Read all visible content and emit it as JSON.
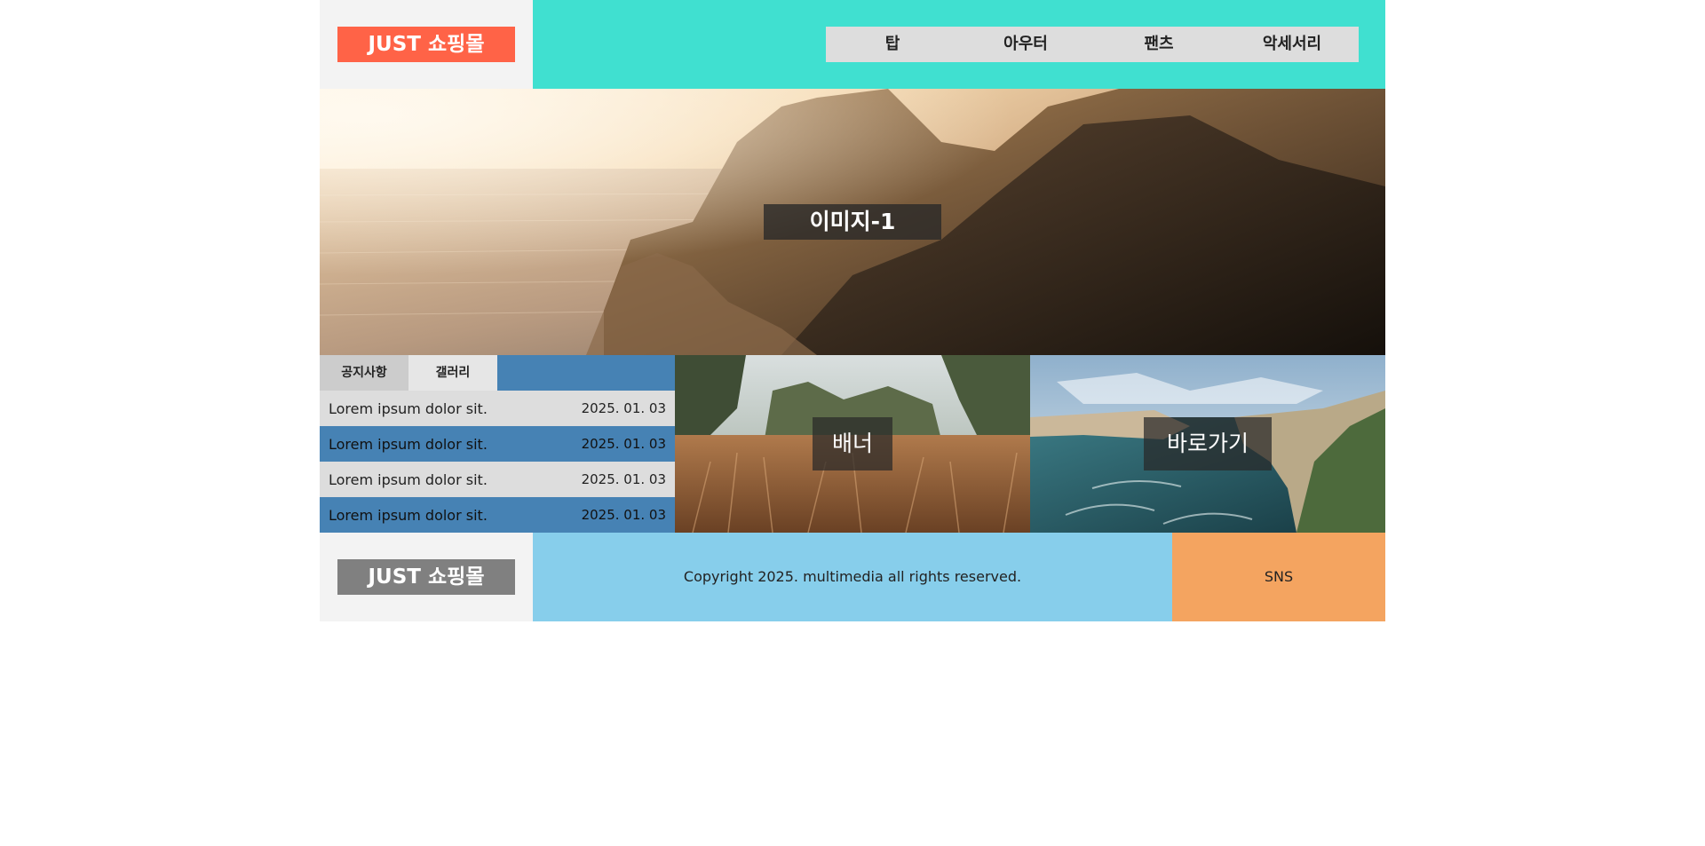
{
  "header": {
    "logo": "JUST 쇼핑몰",
    "menu": [
      "탑",
      "아우터",
      "팬츠",
      "악세서리"
    ]
  },
  "slider": {
    "caption": "이미지-1"
  },
  "board": {
    "tabs": [
      "공지사항",
      "갤러리"
    ],
    "rows": [
      {
        "title": "Lorem ipsum dolor sit.",
        "date": "2025. 01. 03"
      },
      {
        "title": "Lorem ipsum dolor sit.",
        "date": "2025. 01. 03"
      },
      {
        "title": "Lorem ipsum dolor sit.",
        "date": "2025. 01. 03"
      },
      {
        "title": "Lorem ipsum dolor sit.",
        "date": "2025. 01. 03"
      }
    ]
  },
  "banner": {
    "caption": "배너"
  },
  "shortcut": {
    "caption": "바로가기"
  },
  "footer": {
    "logo": "JUST 쇼핑몰",
    "copyright": "Copyright 2025. multimedia all rights reserved.",
    "sns": "SNS"
  },
  "colors": {
    "logo_bg": "#ff6347",
    "nav_bg": "#40e0d0",
    "menu_bg": "#dddddd",
    "board_accent": "#4682b4",
    "copyright_bg": "#87ceeb",
    "sns_bg": "#f4a460",
    "footer_logo_bg": "#808080"
  }
}
